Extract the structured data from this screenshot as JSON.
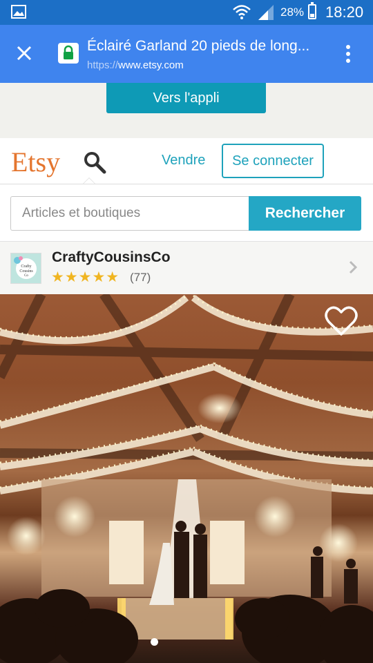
{
  "status_bar": {
    "battery_percent": "28%",
    "battery_level": 0.28,
    "time": "18:20"
  },
  "browser": {
    "page_title": "Éclairé Garland 20 pieds de long...",
    "url_protocol": "https://",
    "url_host": "www.etsy.com"
  },
  "app_banner": {
    "open_app_label": "Vers l'appli"
  },
  "header": {
    "logo": "Etsy",
    "sell_label": "Vendre",
    "sign_in_label": "Se connecter"
  },
  "search": {
    "placeholder": "Articles et boutiques",
    "button_label": "Rechercher"
  },
  "shop": {
    "avatar_text": "Crafty Cousins Co",
    "name": "CraftyCousinsCo",
    "stars_display": "★★★★★",
    "rating": 5,
    "review_count": "(77)"
  },
  "listing_image": {
    "current_index": 1,
    "dot_count": 1
  },
  "colors": {
    "status_bar": "#1c6fc6",
    "url_bar": "#3f84ee",
    "etsy_orange": "#e4752e",
    "teal_accent": "#1ea2bb",
    "search_button": "#24a7c5",
    "star": "#f0b521"
  },
  "icons": [
    "image-icon",
    "wifi-icon",
    "signal-icon",
    "battery-icon",
    "close-icon",
    "lock-icon",
    "overflow-menu-icon",
    "search-icon",
    "cart-icon",
    "chevron-right-icon",
    "heart-icon"
  ]
}
